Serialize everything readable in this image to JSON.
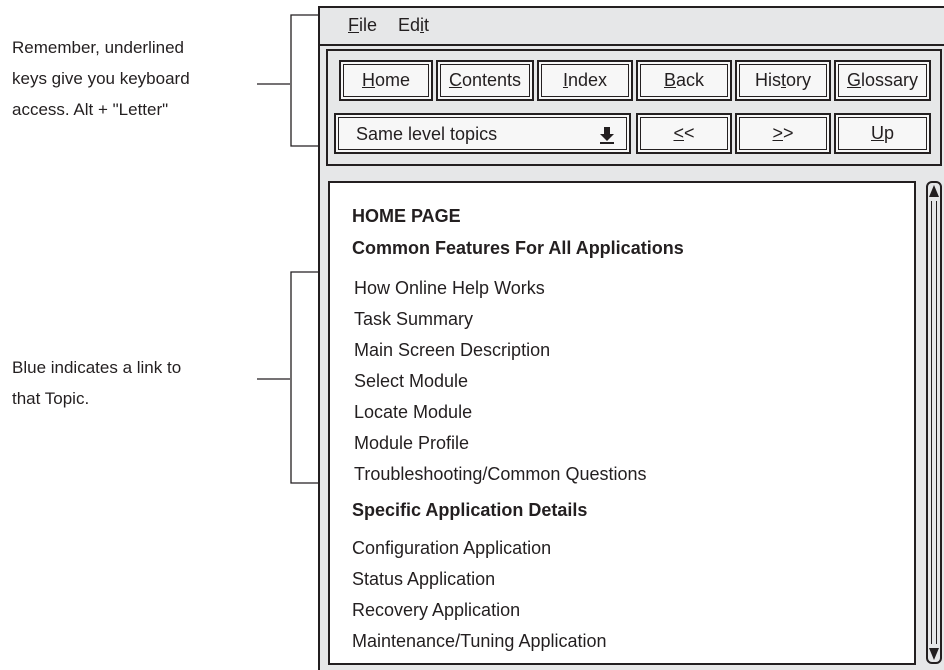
{
  "annotations": {
    "keyboard": [
      "Remember, underlined",
      "keys give you keyboard",
      "access. Alt + \"Letter\""
    ],
    "link": [
      "Blue indicates a link to",
      "that Topic."
    ]
  },
  "menubar": {
    "file": {
      "underlined": "F",
      "rest": "ile"
    },
    "edit": {
      "pre": "Ed",
      "underlined": "i",
      "rest": "t"
    }
  },
  "toolbar": {
    "buttons": [
      {
        "pre": "",
        "u": "H",
        "post": "ome"
      },
      {
        "pre": "",
        "u": "C",
        "post": "ontents"
      },
      {
        "pre": "",
        "u": "I",
        "post": "ndex"
      },
      {
        "pre": "",
        "u": "B",
        "post": "ack"
      },
      {
        "pre": "His",
        "u": "t",
        "post": "ory"
      },
      {
        "pre": "",
        "u": "G",
        "post": "lossary"
      }
    ],
    "dropdown_value": "Same level topics",
    "prev": {
      "pre": "",
      "u": "<",
      "post": "<"
    },
    "next": {
      "pre": "",
      "u": ">",
      "post": ">"
    },
    "up": {
      "pre": "",
      "u": "U",
      "post": "p"
    }
  },
  "content": {
    "title": "HOME PAGE",
    "common_heading": "Common Features For All Applications",
    "common_links": [
      "How Online Help Works",
      "Task Summary",
      "Main Screen Description",
      "Select Module",
      "Locate Module",
      "Module Profile",
      "Troubleshooting/Common Questions"
    ],
    "specific_heading": "Specific Application Details",
    "specific_links": [
      "Configuration Application",
      "Status Application",
      "Recovery Application",
      "Maintenance/Tuning Application"
    ]
  }
}
